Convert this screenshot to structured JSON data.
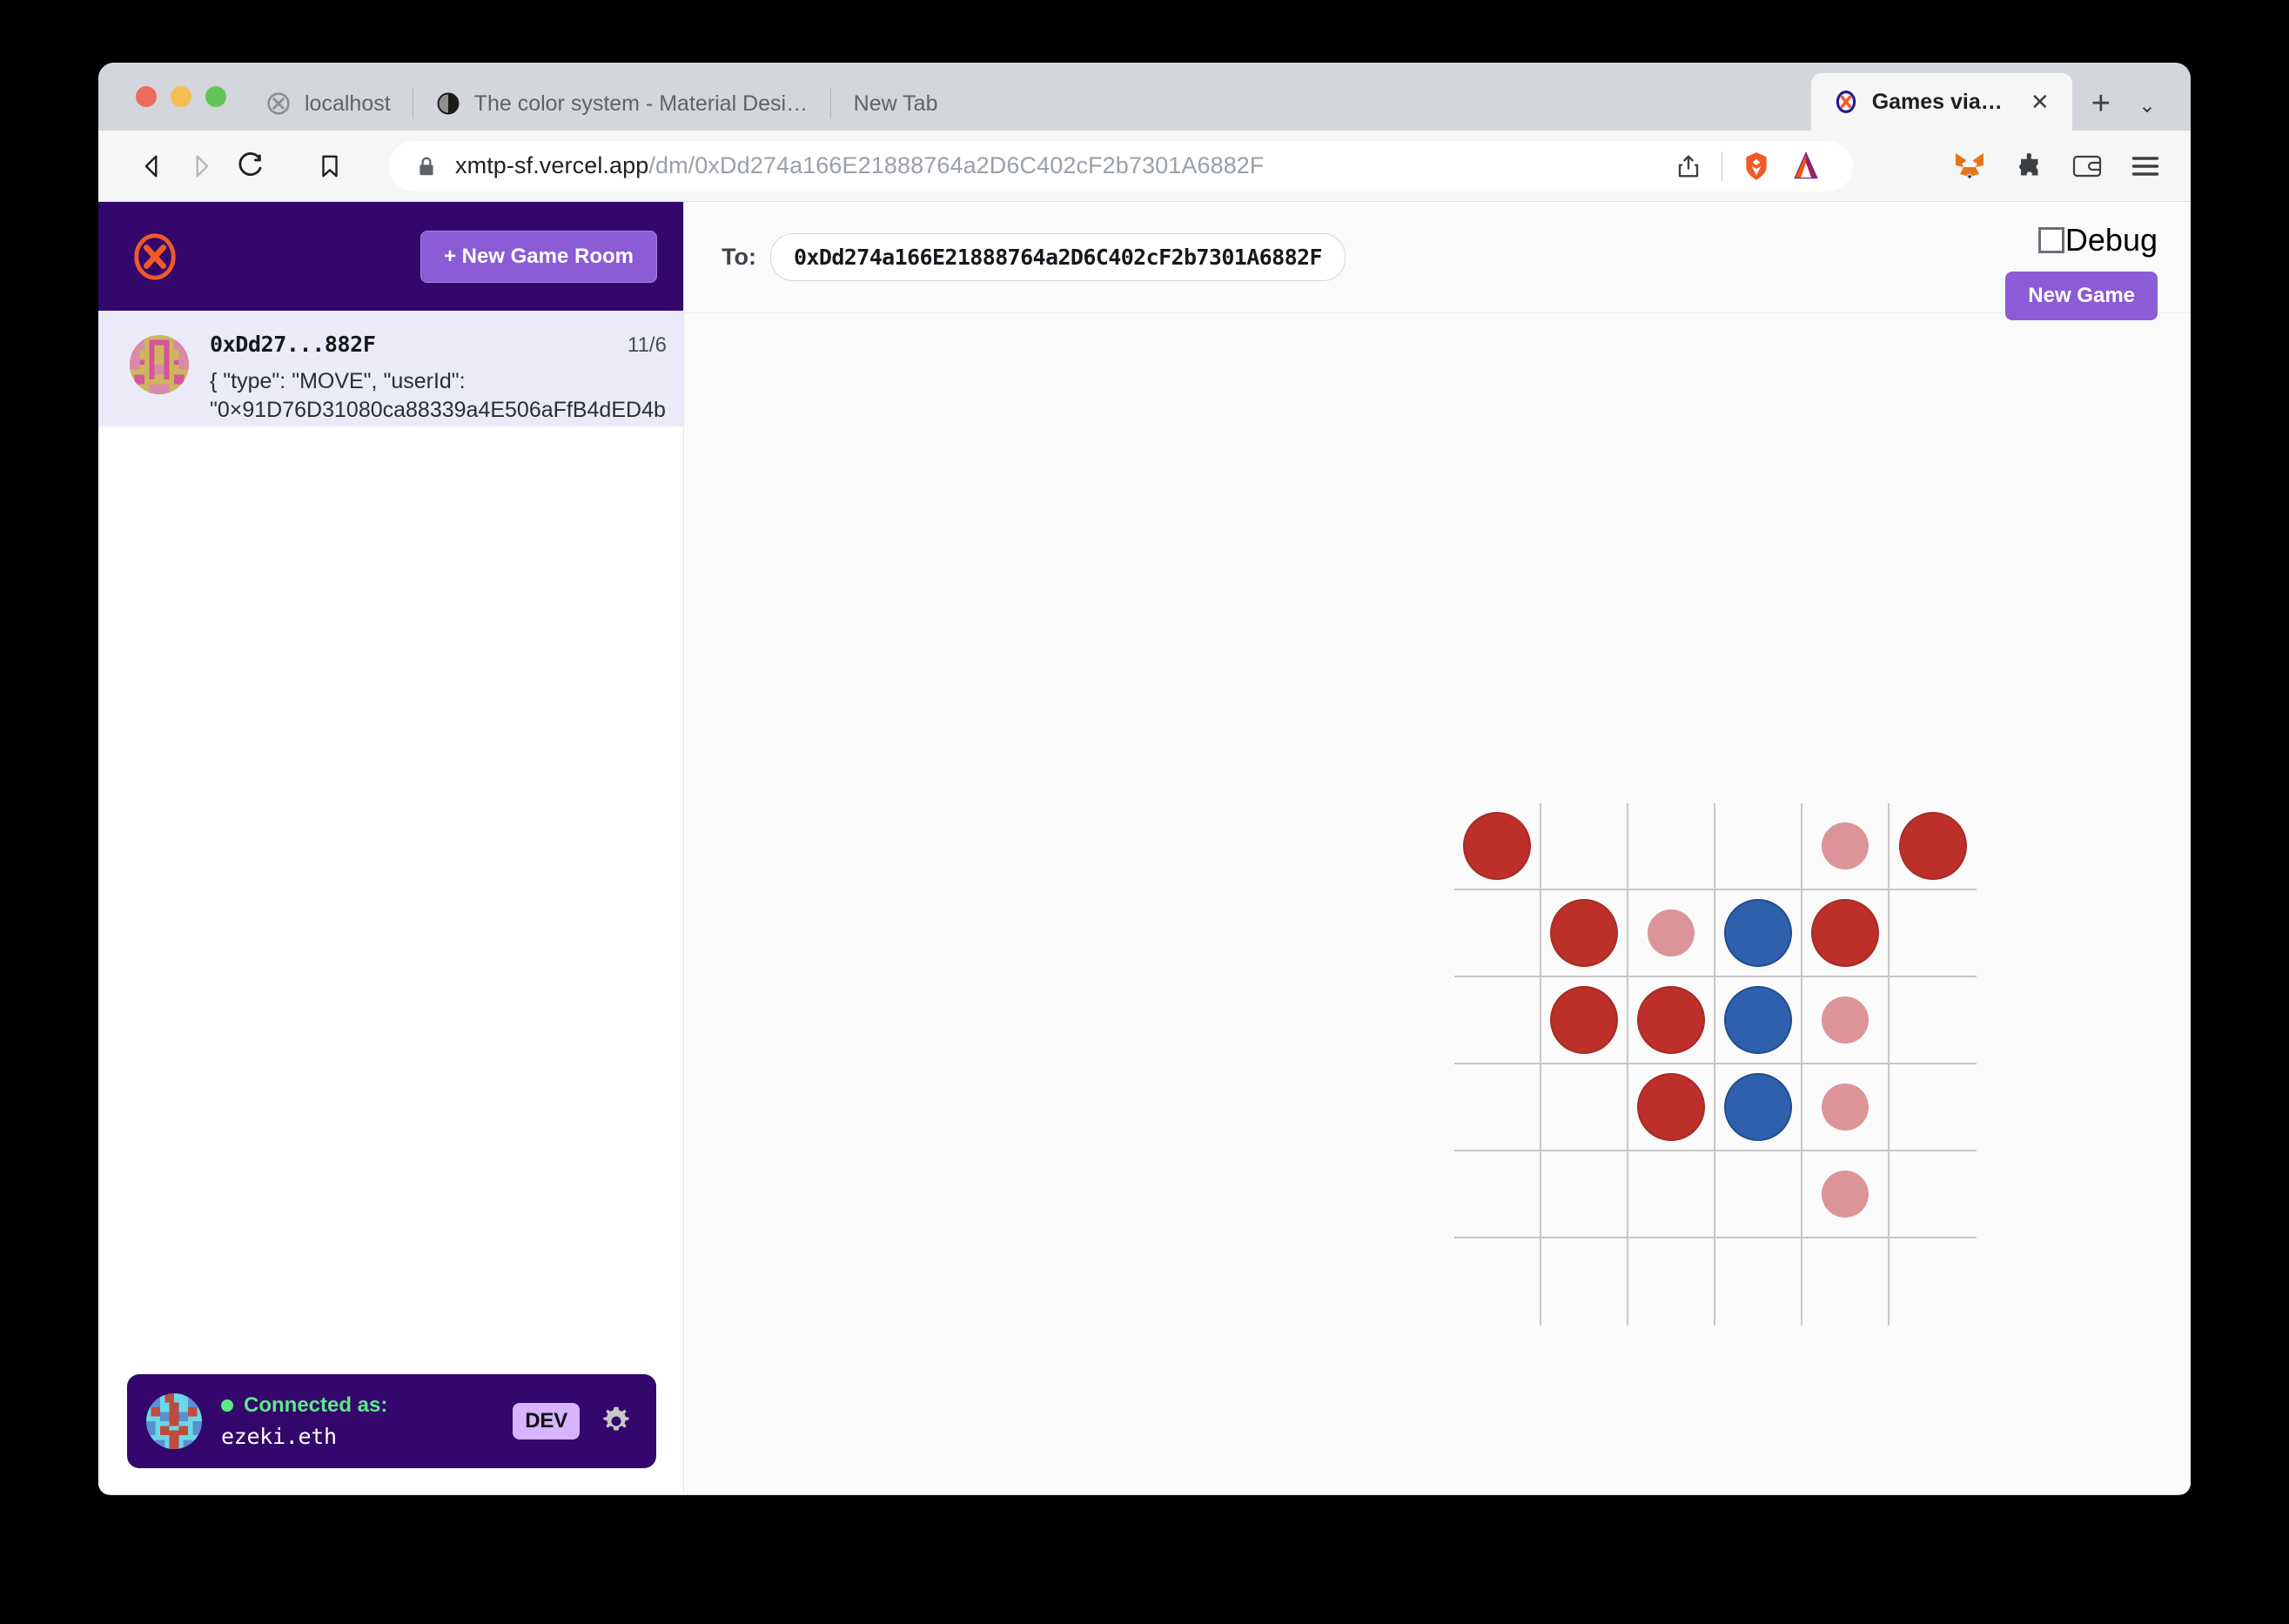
{
  "browser": {
    "tabs": [
      {
        "title": "localhost",
        "favicon": "xmtp-gray-icon",
        "active": false
      },
      {
        "title": "The color system - Material Design",
        "favicon": "material-design-icon",
        "active": false
      },
      {
        "title": "New Tab",
        "favicon": "none",
        "active": false
      },
      {
        "title": "Games via XMTP",
        "favicon": "xmtp-orange-icon",
        "active": true
      }
    ],
    "tab_close_label": "✕",
    "new_tab_label": "+",
    "tab_list_label": "⌄",
    "url": {
      "domain": "xmtp-sf.vercel.app",
      "path": "/dm/0xDd274a166E21888764a2D6C402cF2b7301A6882F"
    },
    "nav": {
      "back": "back-icon",
      "forward": "forward-icon",
      "reload": "reload-icon",
      "bookmark": "bookmark-icon"
    },
    "url_icons": [
      "lock-icon",
      "share-icon",
      "brave-shield-icon",
      "bat-rewards-icon"
    ],
    "toolbar_icons": [
      "metamask-icon",
      "extensions-icon",
      "brave-wallet-icon",
      "menu-icon"
    ]
  },
  "sidebar": {
    "logo": "xmtp-logo",
    "new_game_room_button": "+ New Game Room",
    "conversations": [
      {
        "name": "0xDd27...882F",
        "time": "11/6",
        "preview": "{ \"type\": \"MOVE\", \"userId\":\n\"0×91D76D31080ca88339a4E506aFfB4dED4b",
        "avatar": "pixel-avatar-pink"
      }
    ],
    "connected": {
      "status_label": "Connected as:",
      "handle": "ezeki.eth",
      "badge": "DEV",
      "avatar": "pixel-avatar-cyan",
      "gear": "gear-icon",
      "dot_color": "#5bea86"
    }
  },
  "main": {
    "to_label": "To:",
    "to_value": "0xDd274a166E21888764a2D6C402cF2b7301A6882F",
    "to_placeholder": "0x...",
    "debug_label": "Debug",
    "debug_checked": false,
    "new_game_button": "New Game"
  },
  "board": {
    "rows": 6,
    "cols": 6,
    "cell_size": 100,
    "colors": {
      "red": "#bc3029",
      "blue": "#2f60ab",
      "pink": "#dd9498",
      "grid_line": "#c7c7c7"
    },
    "pieces": [
      {
        "row": 0,
        "col": 0,
        "color": "red",
        "size": "large"
      },
      {
        "row": 0,
        "col": 4,
        "color": "pink",
        "size": "small"
      },
      {
        "row": 0,
        "col": 5,
        "color": "red",
        "size": "large"
      },
      {
        "row": 1,
        "col": 1,
        "color": "red",
        "size": "large"
      },
      {
        "row": 1,
        "col": 2,
        "color": "pink",
        "size": "small"
      },
      {
        "row": 1,
        "col": 3,
        "color": "blue",
        "size": "large"
      },
      {
        "row": 1,
        "col": 4,
        "color": "red",
        "size": "large"
      },
      {
        "row": 2,
        "col": 1,
        "color": "red",
        "size": "large"
      },
      {
        "row": 2,
        "col": 2,
        "color": "red",
        "size": "large"
      },
      {
        "row": 2,
        "col": 3,
        "color": "blue",
        "size": "large"
      },
      {
        "row": 2,
        "col": 4,
        "color": "pink",
        "size": "small"
      },
      {
        "row": 3,
        "col": 2,
        "color": "red",
        "size": "large"
      },
      {
        "row": 3,
        "col": 3,
        "color": "blue",
        "size": "large"
      },
      {
        "row": 3,
        "col": 4,
        "color": "pink",
        "size": "small"
      },
      {
        "row": 4,
        "col": 4,
        "color": "pink",
        "size": "small"
      }
    ]
  }
}
